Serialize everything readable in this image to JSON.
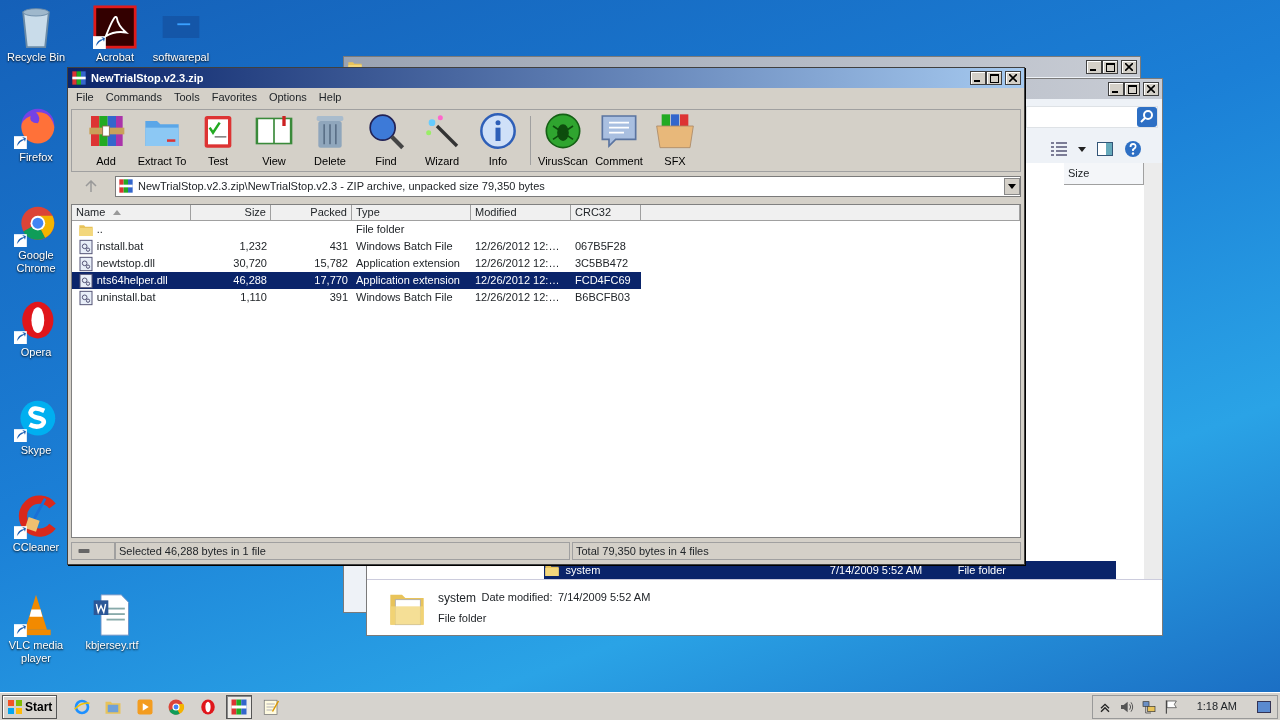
{
  "desktop_icons": [
    {
      "label": "Recycle Bin",
      "kind": "recycle"
    },
    {
      "label": "Acrobat",
      "kind": "acrobat"
    },
    {
      "label": "softwarepal",
      "kind": "window"
    },
    {
      "label": "Firefox",
      "kind": "firefox"
    },
    {
      "label": "Google Chrome",
      "kind": "chrome"
    },
    {
      "label": "Opera",
      "kind": "opera"
    },
    {
      "label": "Skype",
      "kind": "skype"
    },
    {
      "label": "CCleaner",
      "kind": "ccleaner"
    },
    {
      "label": "VLC media player",
      "kind": "vlc"
    },
    {
      "label": "kbjersey.rtf",
      "kind": "word"
    }
  ],
  "explorer": {
    "size_column": "Size",
    "selected_row": {
      "name": "system",
      "date": "7/14/2009 5:52 AM",
      "type": "File folder"
    },
    "details": {
      "name": "system",
      "date_label": "Date modified:",
      "date": "7/14/2009 5:52 AM",
      "type": "File folder"
    }
  },
  "winrar": {
    "title": "NewTrialStop.v2.3.zip",
    "menu": [
      "File",
      "Commands",
      "Tools",
      "Favorites",
      "Options",
      "Help"
    ],
    "toolbar_groups": [
      [
        {
          "label": "Add",
          "kind": "add"
        },
        {
          "label": "Extract To",
          "kind": "extract"
        },
        {
          "label": "Test",
          "kind": "test"
        },
        {
          "label": "View",
          "kind": "view"
        },
        {
          "label": "Delete",
          "kind": "delete"
        },
        {
          "label": "Find",
          "kind": "find"
        },
        {
          "label": "Wizard",
          "kind": "wizard"
        },
        {
          "label": "Info",
          "kind": "info"
        }
      ],
      [
        {
          "label": "VirusScan",
          "kind": "virusscan"
        },
        {
          "label": "Comment",
          "kind": "comment"
        },
        {
          "label": "SFX",
          "kind": "sfx"
        }
      ]
    ],
    "address": "NewTrialStop.v2.3.zip\\NewTrialStop.v2.3 - ZIP archive, unpacked size 79,350 bytes",
    "columns": [
      {
        "label": "Name",
        "sorted": true
      },
      {
        "label": "Size",
        "sorted": false
      },
      {
        "label": "Packed",
        "sorted": false
      },
      {
        "label": "Type",
        "sorted": false
      },
      {
        "label": "Modified",
        "sorted": false
      },
      {
        "label": "CRC32",
        "sorted": false
      }
    ],
    "rows": [
      {
        "kind": "folder",
        "name": "..",
        "size": "",
        "packed": "",
        "type": "File folder",
        "modified": "",
        "crc32": "",
        "selected": false
      },
      {
        "kind": "file",
        "name": "install.bat",
        "size": "1,232",
        "packed": "431",
        "type": "Windows Batch File",
        "modified": "12/26/2012 12:…",
        "crc32": "067B5F28",
        "selected": false
      },
      {
        "kind": "file",
        "name": "newtstop.dll",
        "size": "30,720",
        "packed": "15,782",
        "type": "Application extension",
        "modified": "12/26/2012 12:…",
        "crc32": "3C5BB472",
        "selected": false
      },
      {
        "kind": "file",
        "name": "nts64helper.dll",
        "size": "46,288",
        "packed": "17,770",
        "type": "Application extension",
        "modified": "12/26/2012 12:…",
        "crc32": "FCD4FC69",
        "selected": true
      },
      {
        "kind": "file",
        "name": "uninstall.bat",
        "size": "1,110",
        "packed": "391",
        "type": "Windows Batch File",
        "modified": "12/26/2012 12:…",
        "crc32": "B6BCFB03",
        "selected": false
      }
    ],
    "status_left": "Selected 46,288 bytes in 1 file",
    "status_right": "Total 79,350 bytes in 4 files"
  },
  "taskbar": {
    "start": "Start",
    "apps": [
      {
        "kind": "ie",
        "active": false
      },
      {
        "kind": "explorer",
        "active": false
      },
      {
        "kind": "media",
        "active": false
      },
      {
        "kind": "chrome",
        "active": false
      },
      {
        "kind": "opera",
        "active": false
      },
      {
        "kind": "winrar",
        "active": true
      },
      {
        "kind": "notepad",
        "active": false
      }
    ],
    "clock": "1:18 AM"
  }
}
